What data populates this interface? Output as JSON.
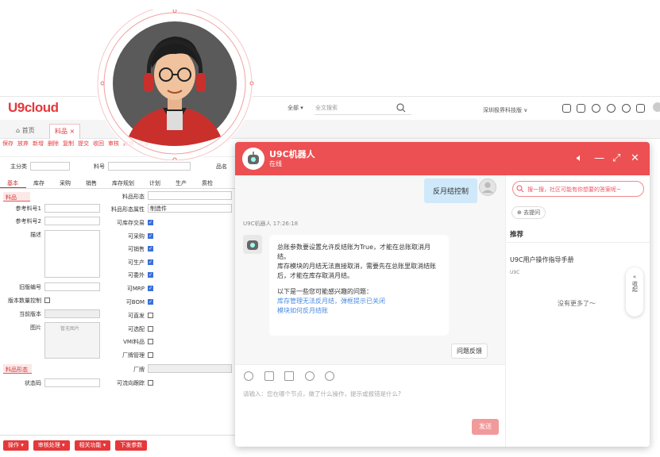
{
  "app": {
    "logo": "U9cloud",
    "search_scope": "全部 ▾",
    "search_placeholder": "全文搜索",
    "company": "深圳极界科技版 ∨"
  },
  "tabs": [
    {
      "label": "首页"
    },
    {
      "label": "料品"
    }
  ],
  "toolbar": [
    "保存",
    "放弃",
    "新增",
    "删除",
    "复制",
    "提交",
    "收回",
    "审核",
    "弃审",
    "批量",
    "..."
  ],
  "form": {
    "top_labels": {
      "org": "主分类",
      "item": "料号",
      "name": "品名"
    },
    "subtabs": [
      "基本",
      "库存",
      "采购",
      "销售",
      "库存规划",
      "计划",
      "生产",
      "质检"
    ],
    "section1": "料品",
    "left_fields": [
      "参考料号1",
      "参考料号2",
      "描述",
      "",
      "",
      "旧版编号",
      "版本数量控制",
      "当前版本",
      "图片"
    ],
    "image_placeholder": "暂无图片",
    "right_labels": [
      "料品形态",
      "料品形态属性",
      "可库存交易",
      "可采购",
      "可销售",
      "可生产",
      "可委外",
      "可MRP",
      "可BOM",
      "可直发",
      "可选配",
      "VMI料品",
      "厂牌管理",
      "厂牌",
      "可流向跟踪"
    ],
    "right_values": {
      "form_attr": "制造件"
    },
    "section2": "料品形态",
    "status_label": "状态码"
  },
  "bottom_buttons": [
    "操作 ▾",
    "审核处理 ▾",
    "相关功能 ▾",
    "下发参数"
  ],
  "chat": {
    "title": "U9C机器人",
    "status": "在线",
    "user_message": "反月结控制",
    "bot_meta": "U9C机器人 17:26:18",
    "bot_lines": [
      "总账参数要设置允许反结账为True，才能在总账取消月结。",
      "库存模块的月结无法直接取消，需要先在总账里取消结账后，才能在库存取消月结。"
    ],
    "bot_suggest_title": "以下是一些您可能感兴趣的问题：",
    "bot_links": [
      "库存管理无法反月结，弹框提示已关闭",
      "模块如何反月结账"
    ],
    "feedback": "问题反馈",
    "input_placeholder": "请输入：您在哪个节点，做了什么操作，提示或报错是什么?",
    "send": "发送",
    "side_search": "搜一搜，社区可能有你想要的答案呢~",
    "ask": "去提问",
    "recommend": "推荐",
    "manual": "U9C用户操作指导手册",
    "manual_sub": "U9C",
    "no_more": "没有更多了～",
    "collapse": "收起"
  },
  "colors": {
    "brand": "#e5383b",
    "chat_header": "#ec5052",
    "user_bubble": "#cfe9fa",
    "link": "#4a8be0"
  }
}
